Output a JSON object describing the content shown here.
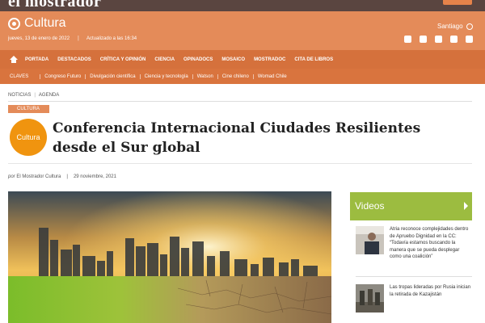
{
  "topbar": {
    "brand": "el mostrador"
  },
  "header": {
    "section": "Cultura",
    "date": "jueves, 13 de enero de 2022",
    "updated": "Actualizado a las 16:34",
    "city": "Santiago",
    "social": [
      "facebook-icon",
      "twitter-icon",
      "instagram-icon",
      "mail-icon",
      "rss-icon"
    ]
  },
  "nav_main": [
    "PORTADA",
    "DESTACADOS",
    "CRÍTICA Y OPINIÓN",
    "CIENCIA",
    "OPINADOCS",
    "MOSAICO",
    "MOSTRADOC",
    "CITA DE LIBROS"
  ],
  "nav_sub": [
    "CLAVES",
    "Congreso Futuro",
    "Divulgación científica",
    "Ciencia y tecnología",
    "Watson",
    "Cine chileno",
    "Womad Chile"
  ],
  "breadcrumb": {
    "first": "NOTICIAS",
    "divider": "|",
    "second": "AGENDA"
  },
  "article": {
    "section_tag": "CULTURA",
    "badge": "Cultura",
    "title": "Conferencia Internacional Ciudades Resilientes desde el Sur global",
    "by_prefix": "por",
    "author": "El Mostrador Cultura",
    "divider": "|",
    "date": "29 noviembre, 2021"
  },
  "sidebar": {
    "heading": "Videos",
    "items": [
      {
        "text": "Atria reconoce complejidades dentro de Apruebo Dignidad en la CC: “Todavía estamos buscando la manera que se pueda desplegar como una coalición”"
      },
      {
        "text": "Las tropas lideradas por Rusia inician la retirada de Kazajistán"
      }
    ]
  },
  "colors": {
    "header": "#e48b59",
    "nav": "#d5713c",
    "accent": "#f0940f",
    "videos": "#9cbc40"
  }
}
